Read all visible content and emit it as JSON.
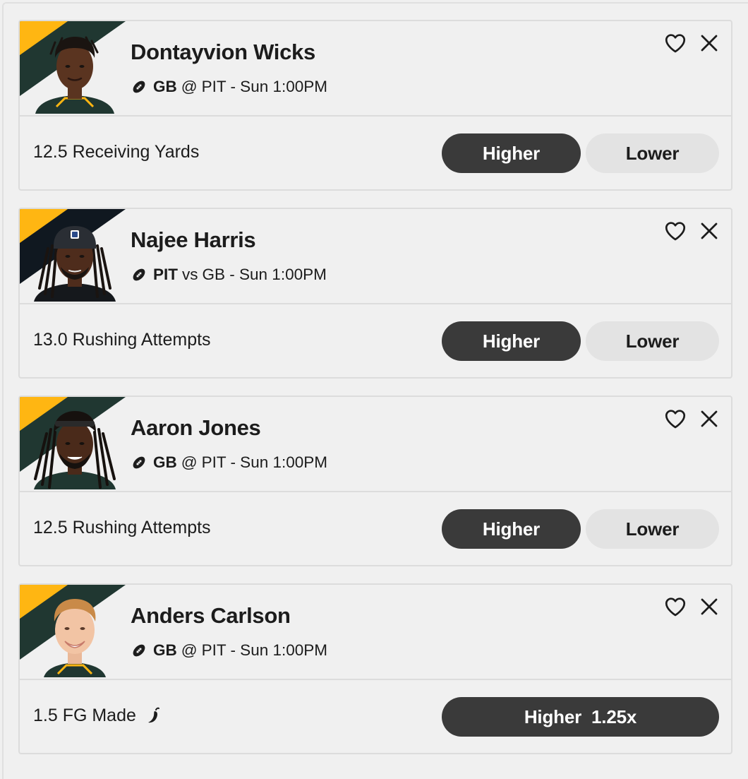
{
  "colors": {
    "banner_green": "#203731",
    "banner_gold": "#FFB612",
    "banner_black": "#101820",
    "higher_bg": "#3a3a3a",
    "lower_bg": "#e3e3e3"
  },
  "cards": [
    {
      "player_name": "Dontayvion Wicks",
      "team": "GB",
      "connector": "@",
      "opponent_time": "PIT - Sun 1:00PM",
      "stat": "12.5 Receiving Yards",
      "higher_label": "Higher",
      "lower_label": "Lower",
      "icons": [
        "football-icon",
        "heart-icon",
        "close-icon"
      ]
    },
    {
      "player_name": "Najee Harris",
      "team": "PIT",
      "connector": "vs",
      "opponent_time": "GB - Sun 1:00PM",
      "stat": "13.0 Rushing Attempts",
      "higher_label": "Higher",
      "lower_label": "Lower",
      "icons": [
        "football-icon",
        "heart-icon",
        "close-icon"
      ]
    },
    {
      "player_name": "Aaron Jones",
      "team": "GB",
      "connector": "@",
      "opponent_time": "PIT - Sun 1:00PM",
      "stat": "12.5 Rushing Attempts",
      "higher_label": "Higher",
      "lower_label": "Lower",
      "icons": [
        "football-icon",
        "heart-icon",
        "close-icon"
      ]
    },
    {
      "player_name": "Anders Carlson",
      "team": "GB",
      "connector": "@",
      "opponent_time": "PIT - Sun 1:00PM",
      "stat": "1.5 FG Made",
      "higher_label": "Higher  1.25x",
      "icons": [
        "football-icon",
        "chili-pepper-icon",
        "heart-icon",
        "close-icon"
      ]
    }
  ]
}
